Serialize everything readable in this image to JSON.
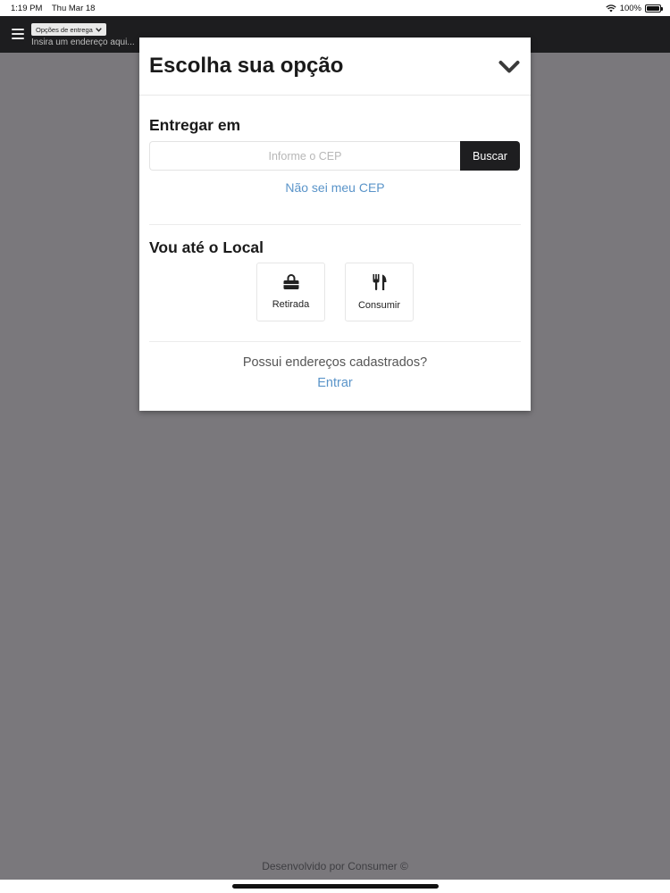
{
  "status_bar": {
    "time": "1:19 PM",
    "date": "Thu Mar 18",
    "battery": "100%"
  },
  "header": {
    "delivery_options_label": "Opções de entrega",
    "address_placeholder": "Insira um endereço aqui..."
  },
  "modal": {
    "title": "Escolha sua opção",
    "deliver_section": {
      "title": "Entregar em",
      "cep_placeholder": "Informe o CEP",
      "cep_value": "",
      "search_button": "Buscar",
      "unknown_cep_link": "Não sei meu CEP"
    },
    "local_section": {
      "title": "Vou até o Local",
      "options": [
        {
          "label": "Retirada",
          "icon": "shopping-bag-icon"
        },
        {
          "label": "Consumir",
          "icon": "utensils-icon"
        }
      ]
    },
    "registered": {
      "question": "Possui endereços cadastrados?",
      "login_link": "Entrar"
    }
  },
  "footer": {
    "text": "Desenvolvido por Consumer ©"
  },
  "colors": {
    "overlay": "#7a787c",
    "header_bg": "#1d1d1f",
    "link": "#5a94c9",
    "button_bg": "#1e1e20"
  }
}
